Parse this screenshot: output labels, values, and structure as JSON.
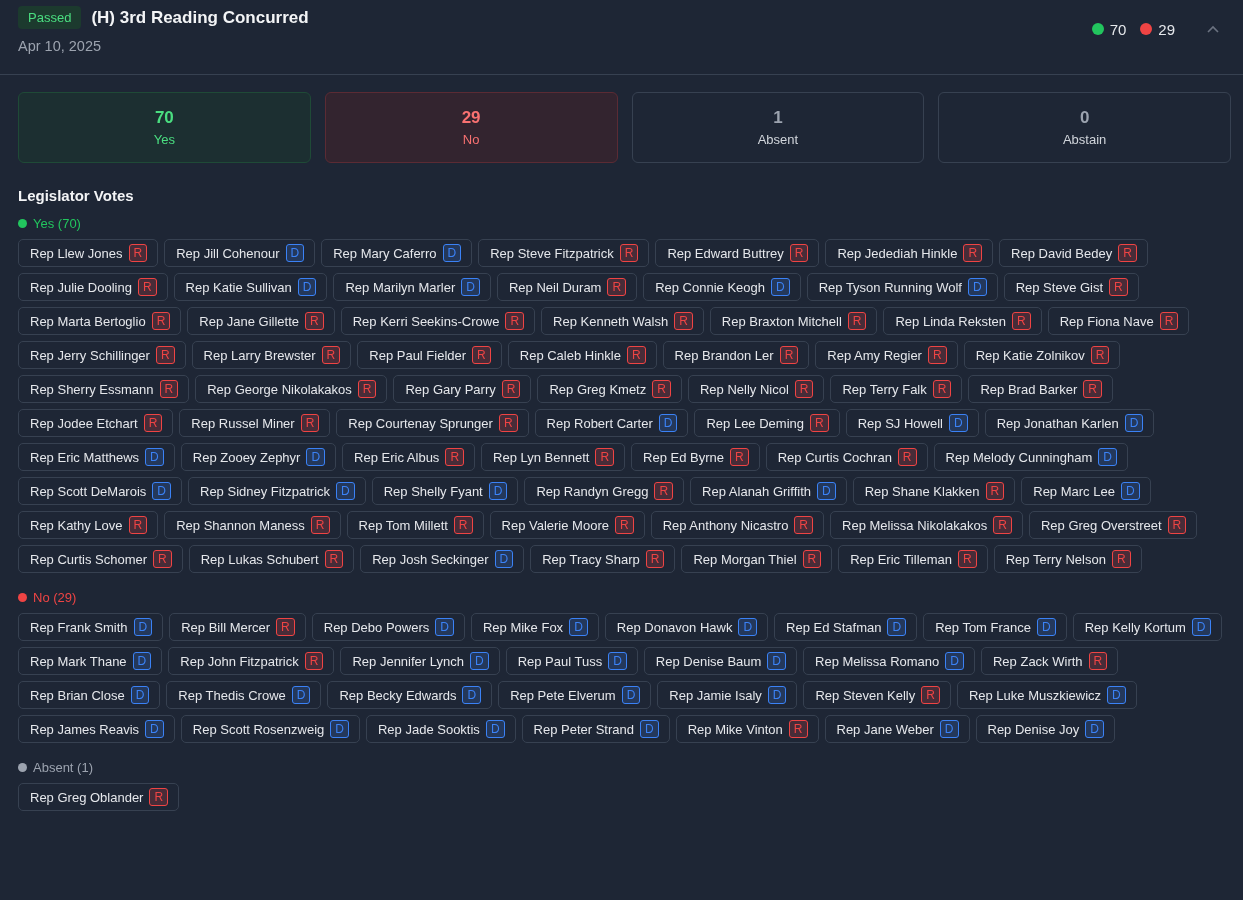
{
  "header": {
    "status": "Passed",
    "title": "(H) 3rd Reading Concurred",
    "date": "Apr 10, 2025",
    "counts": [
      {
        "value": "70",
        "color": "#22c55e"
      },
      {
        "value": "29",
        "color": "#ef4444"
      }
    ],
    "expanded": true
  },
  "summary": [
    {
      "kind": "yes",
      "value": "70",
      "label": "Yes"
    },
    {
      "kind": "no",
      "value": "29",
      "label": "No"
    },
    {
      "kind": "neutral",
      "value": "1",
      "label": "Absent"
    },
    {
      "kind": "neutral",
      "value": "0",
      "label": "Abstain"
    }
  ],
  "section_title": "Legislator Votes",
  "groups": [
    {
      "label": "Yes (70)",
      "color": "#22c55e",
      "legislators": [
        {
          "name": "Rep Llew Jones",
          "party": "R",
          "color": "#ef4444"
        },
        {
          "name": "Rep Jill Cohenour",
          "party": "D",
          "color": "#3b82f6"
        },
        {
          "name": "Rep Mary Caferro",
          "party": "D",
          "color": "#3b82f6"
        },
        {
          "name": "Rep Steve Fitzpatrick",
          "party": "R",
          "color": "#ef4444"
        },
        {
          "name": "Rep Edward Buttrey",
          "party": "R",
          "color": "#ef4444"
        },
        {
          "name": "Rep Jedediah Hinkle",
          "party": "R",
          "color": "#ef4444"
        },
        {
          "name": "Rep David Bedey",
          "party": "R",
          "color": "#ef4444"
        },
        {
          "name": "Rep Julie Dooling",
          "party": "R",
          "color": "#ef4444"
        },
        {
          "name": "Rep Katie Sullivan",
          "party": "D",
          "color": "#3b82f6"
        },
        {
          "name": "Rep Marilyn Marler",
          "party": "D",
          "color": "#3b82f6"
        },
        {
          "name": "Rep Neil Duram",
          "party": "R",
          "color": "#ef4444"
        },
        {
          "name": "Rep Connie Keogh",
          "party": "D",
          "color": "#3b82f6"
        },
        {
          "name": "Rep Tyson Running Wolf",
          "party": "D",
          "color": "#3b82f6"
        },
        {
          "name": "Rep Steve Gist",
          "party": "R",
          "color": "#ef4444"
        },
        {
          "name": "Rep Marta Bertoglio",
          "party": "R",
          "color": "#ef4444"
        },
        {
          "name": "Rep Jane Gillette",
          "party": "R",
          "color": "#ef4444"
        },
        {
          "name": "Rep Kerri Seekins-Crowe",
          "party": "R",
          "color": "#ef4444"
        },
        {
          "name": "Rep Kenneth Walsh",
          "party": "R",
          "color": "#ef4444"
        },
        {
          "name": "Rep Braxton Mitchell",
          "party": "R",
          "color": "#ef4444"
        },
        {
          "name": "Rep Linda Reksten",
          "party": "R",
          "color": "#ef4444"
        },
        {
          "name": "Rep Fiona Nave",
          "party": "R",
          "color": "#ef4444"
        },
        {
          "name": "Rep Jerry Schillinger",
          "party": "R",
          "color": "#ef4444"
        },
        {
          "name": "Rep Larry Brewster",
          "party": "R",
          "color": "#ef4444"
        },
        {
          "name": "Rep Paul Fielder",
          "party": "R",
          "color": "#ef4444"
        },
        {
          "name": "Rep Caleb Hinkle",
          "party": "R",
          "color": "#ef4444"
        },
        {
          "name": "Rep Brandon Ler",
          "party": "R",
          "color": "#ef4444"
        },
        {
          "name": "Rep Amy Regier",
          "party": "R",
          "color": "#ef4444"
        },
        {
          "name": "Rep Katie Zolnikov",
          "party": "R",
          "color": "#ef4444"
        },
        {
          "name": "Rep Sherry Essmann",
          "party": "R",
          "color": "#ef4444"
        },
        {
          "name": "Rep George Nikolakakos",
          "party": "R",
          "color": "#ef4444"
        },
        {
          "name": "Rep Gary Parry",
          "party": "R",
          "color": "#ef4444"
        },
        {
          "name": "Rep Greg Kmetz",
          "party": "R",
          "color": "#ef4444"
        },
        {
          "name": "Rep Nelly Nicol",
          "party": "R",
          "color": "#ef4444"
        },
        {
          "name": "Rep Terry Falk",
          "party": "R",
          "color": "#ef4444"
        },
        {
          "name": "Rep Brad Barker",
          "party": "R",
          "color": "#ef4444"
        },
        {
          "name": "Rep Jodee Etchart",
          "party": "R",
          "color": "#ef4444"
        },
        {
          "name": "Rep Russel Miner",
          "party": "R",
          "color": "#ef4444"
        },
        {
          "name": "Rep Courtenay Sprunger",
          "party": "R",
          "color": "#ef4444"
        },
        {
          "name": "Rep Robert Carter",
          "party": "D",
          "color": "#3b82f6"
        },
        {
          "name": "Rep Lee Deming",
          "party": "R",
          "color": "#ef4444"
        },
        {
          "name": "Rep SJ Howell",
          "party": "D",
          "color": "#3b82f6"
        },
        {
          "name": "Rep Jonathan Karlen",
          "party": "D",
          "color": "#3b82f6"
        },
        {
          "name": "Rep Eric Matthews",
          "party": "D",
          "color": "#3b82f6"
        },
        {
          "name": "Rep Zooey Zephyr",
          "party": "D",
          "color": "#3b82f6"
        },
        {
          "name": "Rep Eric Albus",
          "party": "R",
          "color": "#ef4444"
        },
        {
          "name": "Rep Lyn Bennett",
          "party": "R",
          "color": "#ef4444"
        },
        {
          "name": "Rep Ed Byrne",
          "party": "R",
          "color": "#ef4444"
        },
        {
          "name": "Rep Curtis Cochran",
          "party": "R",
          "color": "#ef4444"
        },
        {
          "name": "Rep Melody Cunningham",
          "party": "D",
          "color": "#3b82f6"
        },
        {
          "name": "Rep Scott DeMarois",
          "party": "D",
          "color": "#3b82f6"
        },
        {
          "name": "Rep Sidney Fitzpatrick",
          "party": "D",
          "color": "#3b82f6"
        },
        {
          "name": "Rep Shelly Fyant",
          "party": "D",
          "color": "#3b82f6"
        },
        {
          "name": "Rep Randyn Gregg",
          "party": "R",
          "color": "#ef4444"
        },
        {
          "name": "Rep Alanah Griffith",
          "party": "D",
          "color": "#3b82f6"
        },
        {
          "name": "Rep Shane Klakken",
          "party": "R",
          "color": "#ef4444"
        },
        {
          "name": "Rep Marc Lee",
          "party": "D",
          "color": "#3b82f6"
        },
        {
          "name": "Rep Kathy Love",
          "party": "R",
          "color": "#ef4444"
        },
        {
          "name": "Rep Shannon Maness",
          "party": "R",
          "color": "#ef4444"
        },
        {
          "name": "Rep Tom Millett",
          "party": "R",
          "color": "#ef4444"
        },
        {
          "name": "Rep Valerie Moore",
          "party": "R",
          "color": "#ef4444"
        },
        {
          "name": "Rep Anthony Nicastro",
          "party": "R",
          "color": "#ef4444"
        },
        {
          "name": "Rep Melissa Nikolakakos",
          "party": "R",
          "color": "#ef4444"
        },
        {
          "name": "Rep Greg Overstreet",
          "party": "R",
          "color": "#ef4444"
        },
        {
          "name": "Rep Curtis Schomer",
          "party": "R",
          "color": "#ef4444"
        },
        {
          "name": "Rep Lukas Schubert",
          "party": "R",
          "color": "#ef4444"
        },
        {
          "name": "Rep Josh Seckinger",
          "party": "D",
          "color": "#3b82f6"
        },
        {
          "name": "Rep Tracy Sharp",
          "party": "R",
          "color": "#ef4444"
        },
        {
          "name": "Rep Morgan Thiel",
          "party": "R",
          "color": "#ef4444"
        },
        {
          "name": "Rep Eric Tilleman",
          "party": "R",
          "color": "#ef4444"
        },
        {
          "name": "Rep Terry Nelson",
          "party": "R",
          "color": "#ef4444"
        }
      ]
    },
    {
      "label": "No (29)",
      "color": "#ef4444",
      "legislators": [
        {
          "name": "Rep Frank Smith",
          "party": "D",
          "color": "#3b82f6"
        },
        {
          "name": "Rep Bill Mercer",
          "party": "R",
          "color": "#ef4444"
        },
        {
          "name": "Rep Debo Powers",
          "party": "D",
          "color": "#3b82f6"
        },
        {
          "name": "Rep Mike Fox",
          "party": "D",
          "color": "#3b82f6"
        },
        {
          "name": "Rep Donavon Hawk",
          "party": "D",
          "color": "#3b82f6"
        },
        {
          "name": "Rep Ed Stafman",
          "party": "D",
          "color": "#3b82f6"
        },
        {
          "name": "Rep Tom France",
          "party": "D",
          "color": "#3b82f6"
        },
        {
          "name": "Rep Kelly Kortum",
          "party": "D",
          "color": "#3b82f6"
        },
        {
          "name": "Rep Mark Thane",
          "party": "D",
          "color": "#3b82f6"
        },
        {
          "name": "Rep John Fitzpatrick",
          "party": "R",
          "color": "#ef4444"
        },
        {
          "name": "Rep Jennifer Lynch",
          "party": "D",
          "color": "#3b82f6"
        },
        {
          "name": "Rep Paul Tuss",
          "party": "D",
          "color": "#3b82f6"
        },
        {
          "name": "Rep Denise Baum",
          "party": "D",
          "color": "#3b82f6"
        },
        {
          "name": "Rep Melissa Romano",
          "party": "D",
          "color": "#3b82f6"
        },
        {
          "name": "Rep Zack Wirth",
          "party": "R",
          "color": "#ef4444"
        },
        {
          "name": "Rep Brian Close",
          "party": "D",
          "color": "#3b82f6"
        },
        {
          "name": "Rep Thedis Crowe",
          "party": "D",
          "color": "#3b82f6"
        },
        {
          "name": "Rep Becky Edwards",
          "party": "D",
          "color": "#3b82f6"
        },
        {
          "name": "Rep Pete Elverum",
          "party": "D",
          "color": "#3b82f6"
        },
        {
          "name": "Rep Jamie Isaly",
          "party": "D",
          "color": "#3b82f6"
        },
        {
          "name": "Rep Steven Kelly",
          "party": "R",
          "color": "#ef4444"
        },
        {
          "name": "Rep Luke Muszkiewicz",
          "party": "D",
          "color": "#3b82f6"
        },
        {
          "name": "Rep James Reavis",
          "party": "D",
          "color": "#3b82f6"
        },
        {
          "name": "Rep Scott Rosenzweig",
          "party": "D",
          "color": "#3b82f6"
        },
        {
          "name": "Rep Jade Sooktis",
          "party": "D",
          "color": "#3b82f6"
        },
        {
          "name": "Rep Peter Strand",
          "party": "D",
          "color": "#3b82f6"
        },
        {
          "name": "Rep Mike Vinton",
          "party": "R",
          "color": "#ef4444"
        },
        {
          "name": "Rep Jane Weber",
          "party": "D",
          "color": "#3b82f6"
        },
        {
          "name": "Rep Denise Joy",
          "party": "D",
          "color": "#3b82f6"
        }
      ]
    },
    {
      "label": "Absent (1)",
      "color": "#9ca3af",
      "legislators": [
        {
          "name": "Rep Greg Oblander",
          "party": "R",
          "color": "#ef4444"
        }
      ]
    }
  ]
}
